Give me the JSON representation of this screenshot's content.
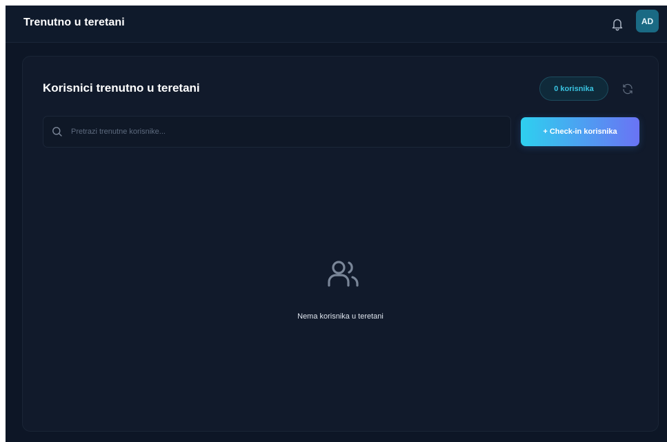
{
  "header": {
    "title": "Trenutno u teretani",
    "avatar_initials": "AD",
    "icons": [
      "bell-icon"
    ]
  },
  "card": {
    "title": "Korisnici trenutno u teretani",
    "count_badge": "0 korisnika",
    "icons": [
      "refresh-icon",
      "search-icon",
      "users-icon"
    ]
  },
  "search": {
    "placeholder": "Pretrazi trenutne korisnike...",
    "value": ""
  },
  "actions": {
    "checkin_label": "+ Check-in korisnika"
  },
  "empty_state": {
    "message": "Nema korisnika u teretani"
  },
  "colors": {
    "background": "#0d1626",
    "card": "#111a2b",
    "accent_cyan": "#39c3e0",
    "gradient_start": "#2ed0ef",
    "gradient_end": "#6a73f4",
    "avatar": "#1a6a84"
  }
}
